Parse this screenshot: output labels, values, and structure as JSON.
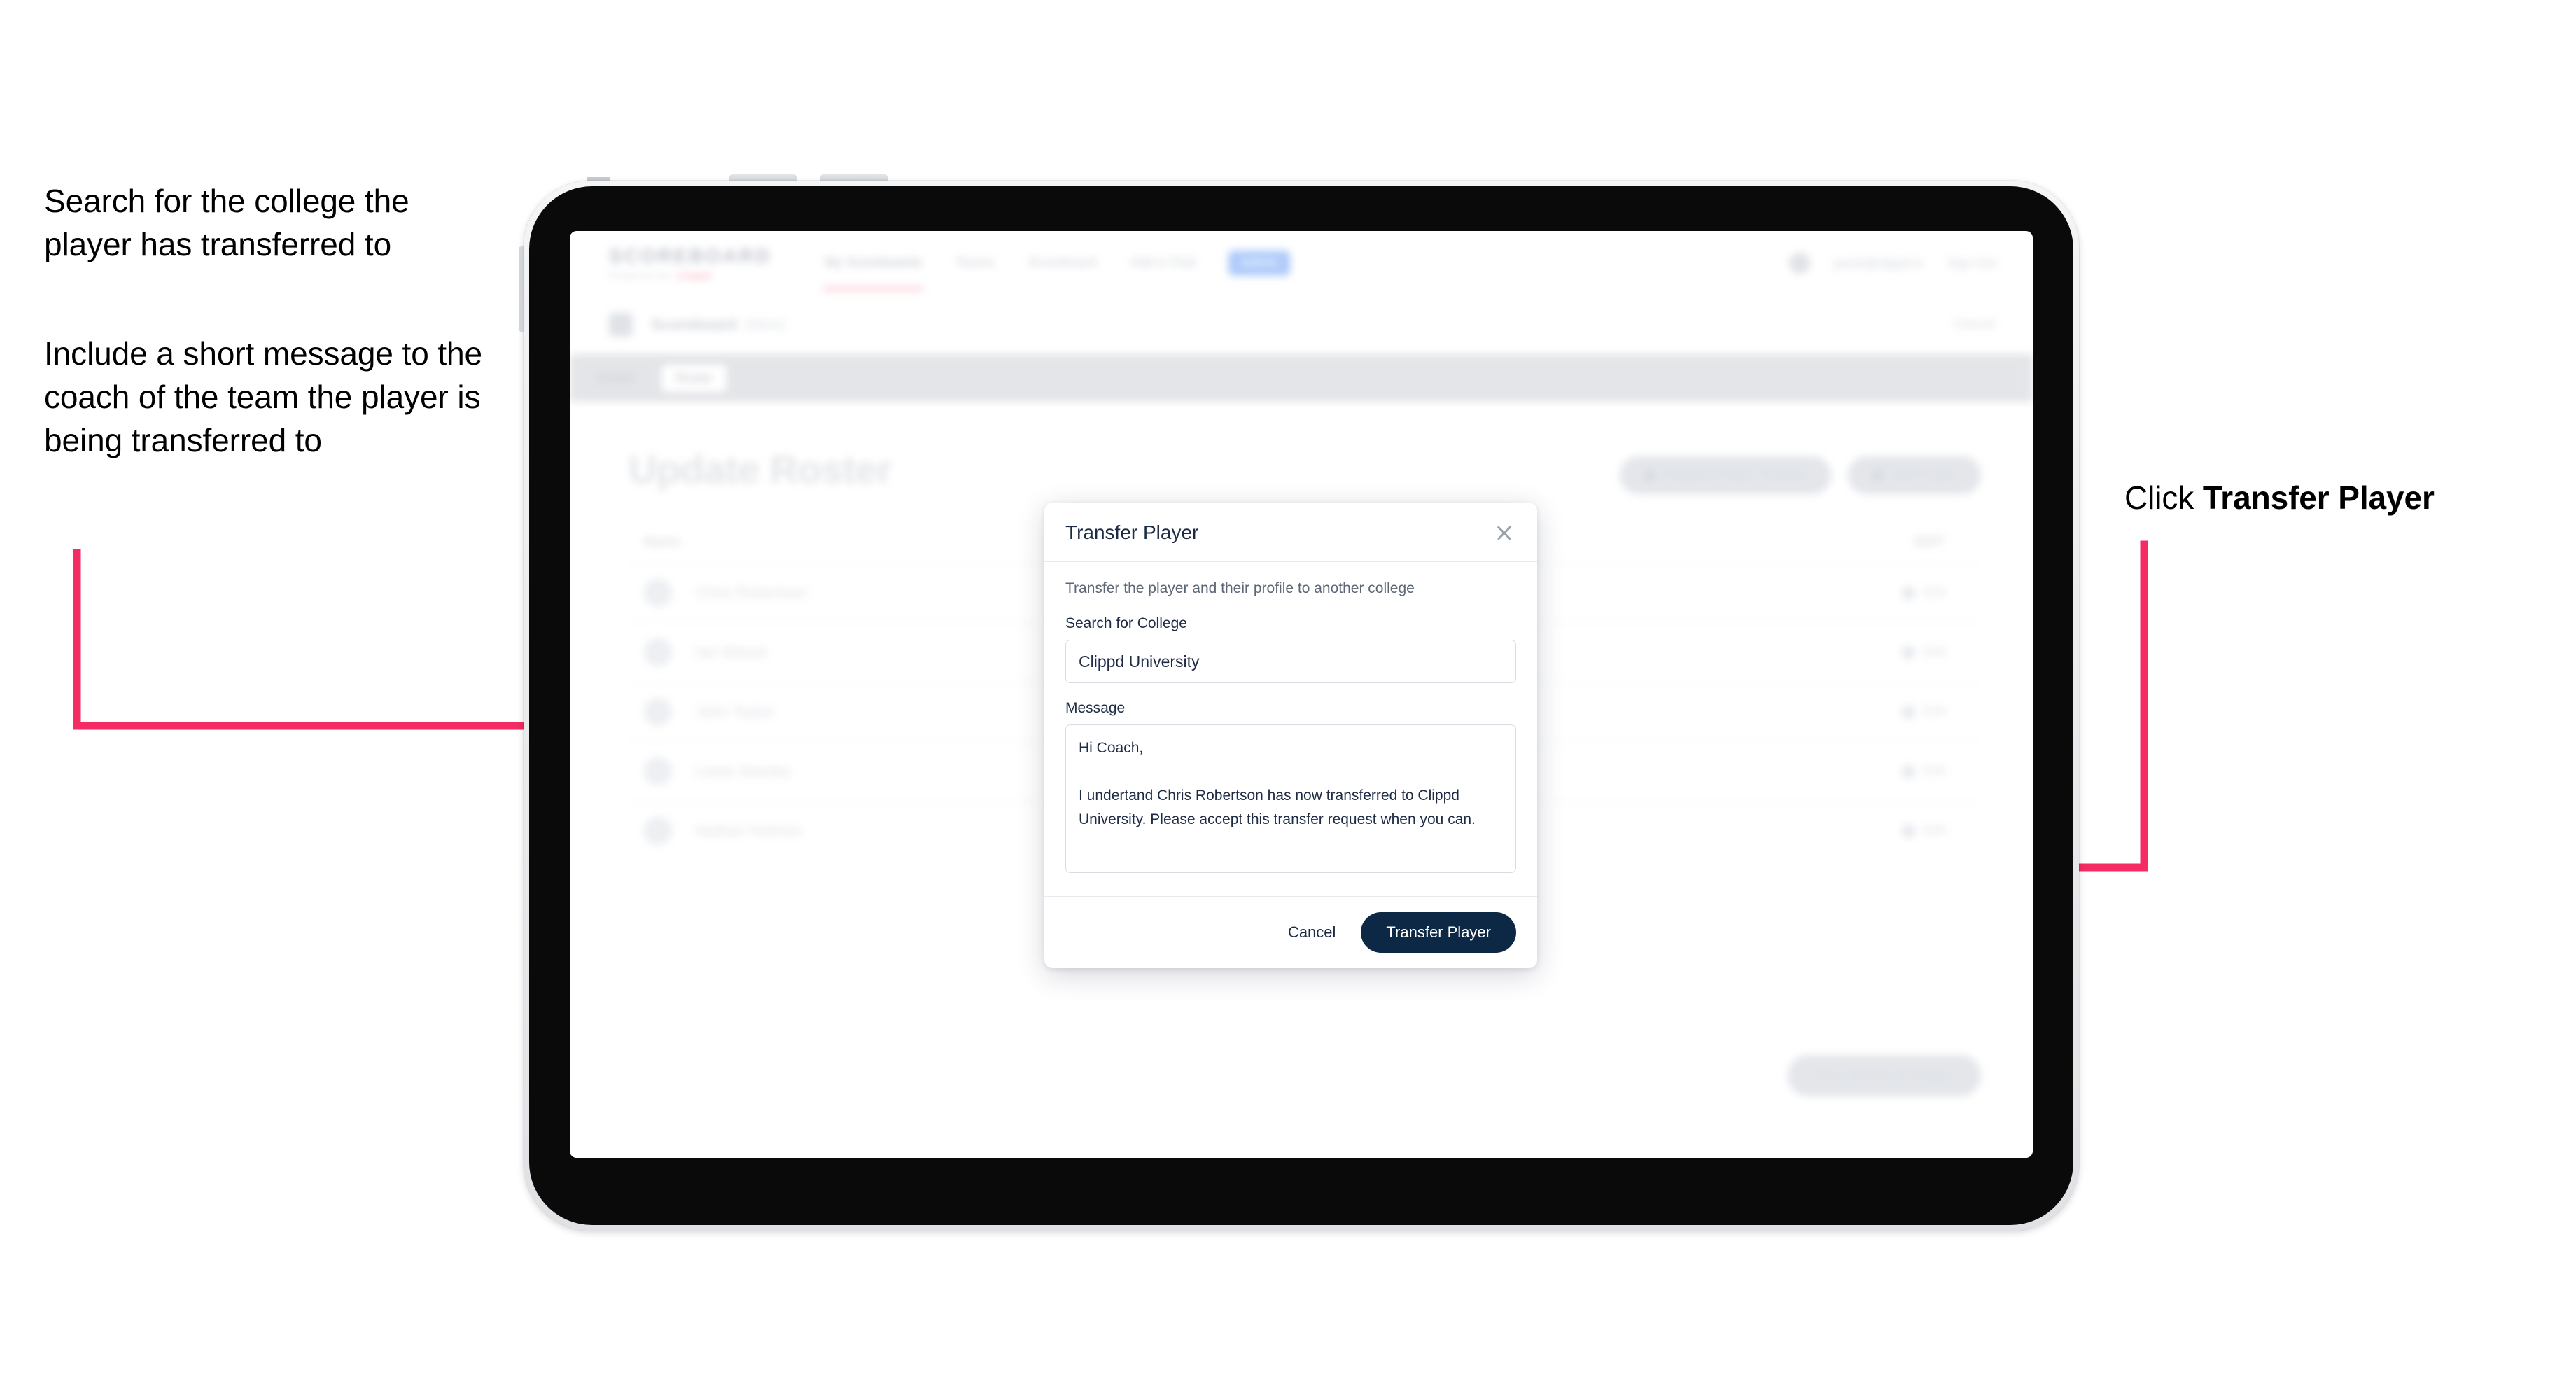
{
  "annotations": {
    "left_1": "Search for the college the player has transferred to",
    "left_2": "Include a short message to the coach of the team the player is being transferred to",
    "right_prefix": "Click ",
    "right_emphasis": "Transfer Player",
    "arrow_color": "#f42c63"
  },
  "app": {
    "brand": {
      "main": "SCOREBOARD",
      "sub": "Powered by",
      "tag": "clippd"
    },
    "nav": {
      "links": [
        {
          "label": "My Scoreboards",
          "active": true
        },
        {
          "label": "Teams",
          "active": false
        },
        {
          "label": "Scoreboard",
          "active": false
        },
        {
          "label": "Add a Club",
          "active": false
        }
      ],
      "pill": "Admin",
      "user_email": "paula@clippd.io",
      "sign_out": "Sign Out"
    },
    "subheader": {
      "title": "Scoreboard",
      "muted": "(Men)",
      "right": "Cancel"
    },
    "tabs": [
      {
        "label": "Details",
        "active": false
      },
      {
        "label": "Roster",
        "active": true
      }
    ],
    "page_title": "Update Roster",
    "actions": [
      {
        "label": "Request Player Transfer",
        "icon": "transfer-icon"
      },
      {
        "label": "Add Player",
        "icon": "plus-icon"
      }
    ],
    "roster": {
      "header_left": "Name",
      "header_right": "EDIT",
      "rows": [
        {
          "name": "Chris Robertson",
          "edit": "Edit"
        },
        {
          "name": "Ian Wilson",
          "edit": "Edit"
        },
        {
          "name": "John Taylor",
          "edit": "Edit"
        },
        {
          "name": "Lewis Stanley",
          "edit": "Edit"
        },
        {
          "name": "Nathan Holmes",
          "edit": "Edit"
        }
      ]
    },
    "save_button": "Save Roster Changes"
  },
  "modal": {
    "title": "Transfer Player",
    "close_icon": "close-icon",
    "description": "Transfer the player and their profile to another college",
    "college": {
      "label": "Search for College",
      "value": "Clippd University",
      "placeholder": "Search for College"
    },
    "message": {
      "label": "Message",
      "value": "Hi Coach,\n\nI undertand Chris Robertson has now transferred to Clippd University. Please accept this transfer request when you can.",
      "placeholder": "Write a message"
    },
    "cancel_label": "Cancel",
    "submit_label": "Transfer Player",
    "primary_color": "#0d2844"
  }
}
